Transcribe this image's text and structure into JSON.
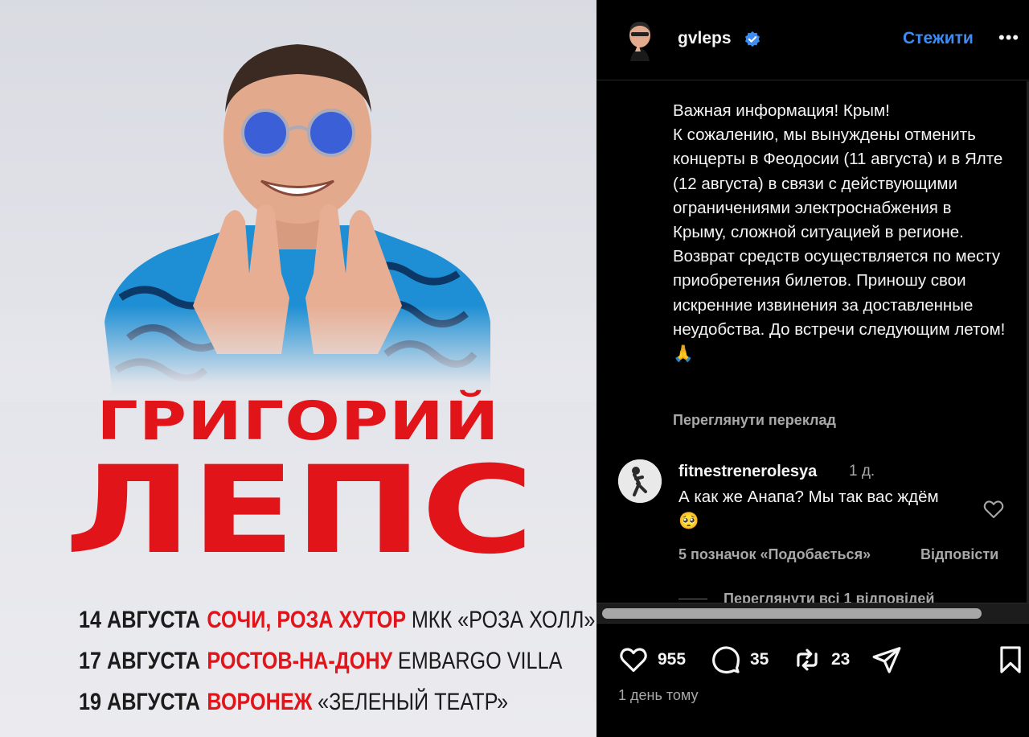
{
  "poster": {
    "first_name": "ГРИГОРИЙ",
    "last_name": "ЛЕПС",
    "concerts": [
      {
        "date": "14 АВГУСТА",
        "city": "СОЧИ, РОЗА ХУТОР",
        "venue": "МКК «РОЗА ХОЛЛ»"
      },
      {
        "date": "17 АВГУСТА",
        "city": "РОСТОВ-НА-ДОНУ",
        "venue": "EMBARGO VILLA"
      },
      {
        "date": "19 АВГУСТА",
        "city": "ВОРОНЕЖ",
        "venue": "«ЗЕЛЕНЫЙ ТЕАТР»"
      }
    ],
    "colors": {
      "accent_red": "#e1141a",
      "background": "#e3e4ea"
    }
  },
  "header": {
    "username": "gvleps",
    "verified_icon": "verified-badge-icon",
    "follow_label": "Стежити",
    "more_label": "•••"
  },
  "caption": {
    "text": "Важная информация! Крым!\nК сожалению, мы вынуждены отменить концерты в Феодосии (11 августа) и в Ялте (12 августа) в связи с действующими ограничениями электроснабжения в Крыму, сложной ситуацией в регионе. Возврат средств осуществляется по месту приобретения билетов. Приношу свои искренние извинения за доставленные неудобства. До встречи следующим летом! 🙏",
    "see_translation": "Переглянути переклад"
  },
  "comment": {
    "username": "fitnestrenerolesya",
    "time": "1 д.",
    "text": "А как же Анапа? Мы так вас ждём🥺",
    "likes_label": "5 позначок «Подобається»",
    "reply_label": "Відповісти",
    "view_replies": "Переглянути всі 1 відповідей"
  },
  "actions": {
    "likes": "955",
    "comments": "35",
    "reposts": "23",
    "timestamp": "1 день тому"
  },
  "colors": {
    "link_blue": "#3d8cf5",
    "secondary_text": "#a8a8a8",
    "panel_bg": "#000000"
  }
}
